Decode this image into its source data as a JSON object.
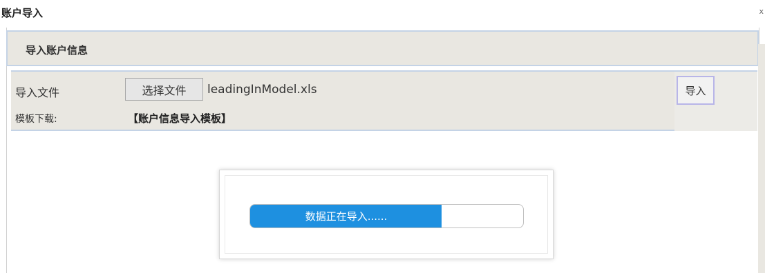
{
  "window": {
    "title": "账户导入",
    "close_glyph": "x"
  },
  "section": {
    "header": "导入账户信息"
  },
  "form": {
    "file_label": "导入文件",
    "choose_button": "选择文件",
    "file_name": "leadingInModel.xls",
    "template_label": "模板下载:",
    "template_link": "【账户信息导入模板】",
    "import_button": "导入"
  },
  "progress": {
    "text": "数据正在导入......",
    "percent": 70,
    "color": "#1e90e0"
  },
  "colors": {
    "panel_bg": "#e9e7e1",
    "panel_border": "#c4d3e6"
  }
}
